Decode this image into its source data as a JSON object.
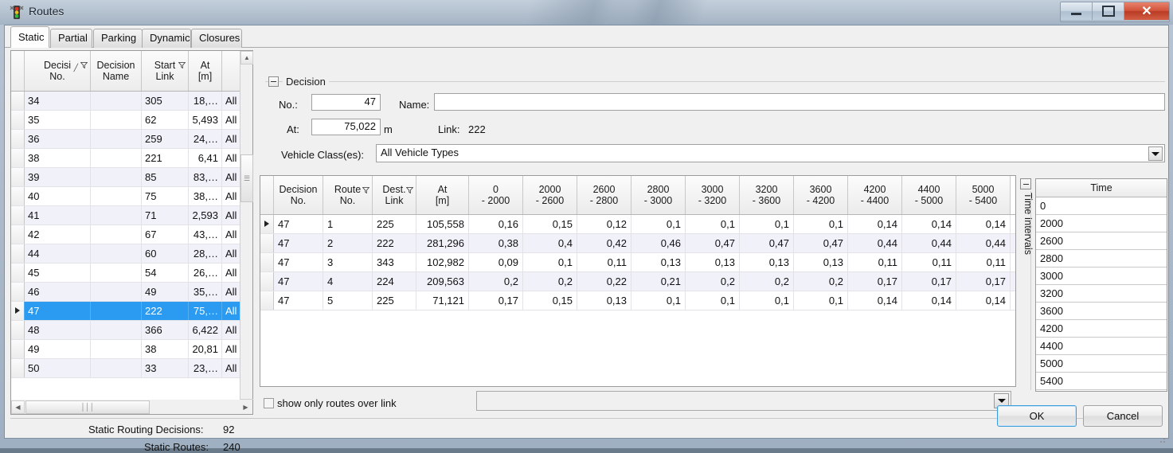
{
  "window": {
    "title": "Routes",
    "icon": "traffic-light-icon",
    "buttons": {
      "minimize": "minimize-icon",
      "maximize": "maximize-icon",
      "close": "close-icon"
    }
  },
  "tabs": [
    {
      "label": "Static",
      "active": true
    },
    {
      "label": "Partial",
      "active": false
    },
    {
      "label": "Parking",
      "active": false
    },
    {
      "label": "Dynamic",
      "active": false
    },
    {
      "label": "Closures",
      "active": false
    }
  ],
  "left_grid": {
    "columns": [
      {
        "line1": "Decisi",
        "line2": "No.",
        "sortable": true,
        "filterable": true
      },
      {
        "line1": "Decision",
        "line2": "Name",
        "sortable": false,
        "filterable": false
      },
      {
        "line1": "Start",
        "line2": "Link",
        "sortable": false,
        "filterable": true
      },
      {
        "line1": "At",
        "line2": "[m]",
        "sortable": false,
        "filterable": false
      },
      {
        "line1": "",
        "line2": "",
        "sortable": false,
        "filterable": false
      }
    ],
    "rows": [
      {
        "no": "34",
        "name": "",
        "start_link": "305",
        "at": "18,…",
        "veh": "All",
        "selected": false
      },
      {
        "no": "35",
        "name": "",
        "start_link": "62",
        "at": "5,493",
        "veh": "All",
        "selected": false
      },
      {
        "no": "36",
        "name": "",
        "start_link": "259",
        "at": "24,…",
        "veh": "All",
        "selected": false
      },
      {
        "no": "38",
        "name": "",
        "start_link": "221",
        "at": "6,41",
        "veh": "All",
        "selected": false
      },
      {
        "no": "39",
        "name": "",
        "start_link": "85",
        "at": "83,…",
        "veh": "All",
        "selected": false
      },
      {
        "no": "40",
        "name": "",
        "start_link": "75",
        "at": "38,…",
        "veh": "All",
        "selected": false
      },
      {
        "no": "41",
        "name": "",
        "start_link": "71",
        "at": "2,593",
        "veh": "All",
        "selected": false
      },
      {
        "no": "42",
        "name": "",
        "start_link": "67",
        "at": "43,…",
        "veh": "All",
        "selected": false
      },
      {
        "no": "44",
        "name": "",
        "start_link": "60",
        "at": "28,…",
        "veh": "All",
        "selected": false
      },
      {
        "no": "45",
        "name": "",
        "start_link": "54",
        "at": "26,…",
        "veh": "All",
        "selected": false
      },
      {
        "no": "46",
        "name": "",
        "start_link": "49",
        "at": "35,…",
        "veh": "All",
        "selected": false
      },
      {
        "no": "47",
        "name": "",
        "start_link": "222",
        "at": "75,…",
        "veh": "All",
        "selected": true
      },
      {
        "no": "48",
        "name": "",
        "start_link": "366",
        "at": "6,422",
        "veh": "All",
        "selected": false
      },
      {
        "no": "49",
        "name": "",
        "start_link": "38",
        "at": "20,81",
        "veh": "All",
        "selected": false
      },
      {
        "no": "50",
        "name": "",
        "start_link": "33",
        "at": "23,…",
        "veh": "All",
        "selected": false
      }
    ]
  },
  "decision": {
    "group_title": "Decision",
    "no_label": "No.:",
    "no_value": "47",
    "name_label": "Name:",
    "name_value": "",
    "at_label": "At:",
    "at_value": "75,022",
    "at_unit": "m",
    "link_label": "Link:",
    "link_value": "222",
    "vehclass_label": "Vehicle Class(es):",
    "vehclass_value": "All Vehicle Types"
  },
  "routes_table": {
    "columns": [
      {
        "line1": "Decision",
        "line2": "No.",
        "filterable": false
      },
      {
        "line1": "Route",
        "line2": "No.",
        "filterable": true
      },
      {
        "line1": "Dest.",
        "line2": "Link",
        "filterable": true
      },
      {
        "line1": "At",
        "line2": "[m]",
        "filterable": false
      },
      {
        "line1": "0",
        "line2": "- 2000",
        "filterable": false
      },
      {
        "line1": "2000",
        "line2": "- 2600",
        "filterable": false
      },
      {
        "line1": "2600",
        "line2": "- 2800",
        "filterable": false
      },
      {
        "line1": "2800",
        "line2": "- 3000",
        "filterable": false
      },
      {
        "line1": "3000",
        "line2": "- 3200",
        "filterable": false
      },
      {
        "line1": "3200",
        "line2": "- 3600",
        "filterable": false
      },
      {
        "line1": "3600",
        "line2": "- 4200",
        "filterable": false
      },
      {
        "line1": "4200",
        "line2": "- 4400",
        "filterable": false
      },
      {
        "line1": "4400",
        "line2": "- 5000",
        "filterable": false
      },
      {
        "line1": "5000",
        "line2": "- 5400",
        "filterable": false
      }
    ],
    "rows": [
      {
        "current": true,
        "cells": [
          "47",
          "1",
          "225",
          "105,558",
          "0,16",
          "0,15",
          "0,12",
          "0,1",
          "0,1",
          "0,1",
          "0,1",
          "0,14",
          "0,14",
          "0,14"
        ]
      },
      {
        "current": false,
        "cells": [
          "47",
          "2",
          "222",
          "281,296",
          "0,38",
          "0,4",
          "0,42",
          "0,46",
          "0,47",
          "0,47",
          "0,47",
          "0,44",
          "0,44",
          "0,44"
        ]
      },
      {
        "current": false,
        "cells": [
          "47",
          "3",
          "343",
          "102,982",
          "0,09",
          "0,1",
          "0,11",
          "0,13",
          "0,13",
          "0,13",
          "0,13",
          "0,11",
          "0,11",
          "0,11"
        ]
      },
      {
        "current": false,
        "cells": [
          "47",
          "4",
          "224",
          "209,563",
          "0,2",
          "0,2",
          "0,22",
          "0,21",
          "0,2",
          "0,2",
          "0,2",
          "0,17",
          "0,17",
          "0,17"
        ]
      },
      {
        "current": false,
        "cells": [
          "47",
          "5",
          "225",
          "71,121",
          "0,17",
          "0,15",
          "0,13",
          "0,1",
          "0,1",
          "0,1",
          "0,1",
          "0,14",
          "0,14",
          "0,14"
        ]
      }
    ]
  },
  "time_intervals": {
    "panel_label": "Time Intervals",
    "column_header": "Time",
    "values": [
      "0",
      "2000",
      "2600",
      "2800",
      "3000",
      "3200",
      "3600",
      "4200",
      "4400",
      "5000",
      "5400"
    ]
  },
  "filters": {
    "show_only_label": "show only routes over link",
    "show_only_checked": false,
    "link_value": ""
  },
  "status": {
    "decisions_label": "Static Routing Decisions:",
    "decisions_value": "92",
    "routes_label": "Static Routes:",
    "routes_value": "240"
  },
  "footer": {
    "ok_label": "OK",
    "cancel_label": "Cancel"
  },
  "colors": {
    "selection": "#2a9bf0",
    "alt_row": "#f1f1fa",
    "accent_button": "#3c9ddd",
    "titlebar": "#b3c0ce",
    "close_button": "#d2523a"
  }
}
